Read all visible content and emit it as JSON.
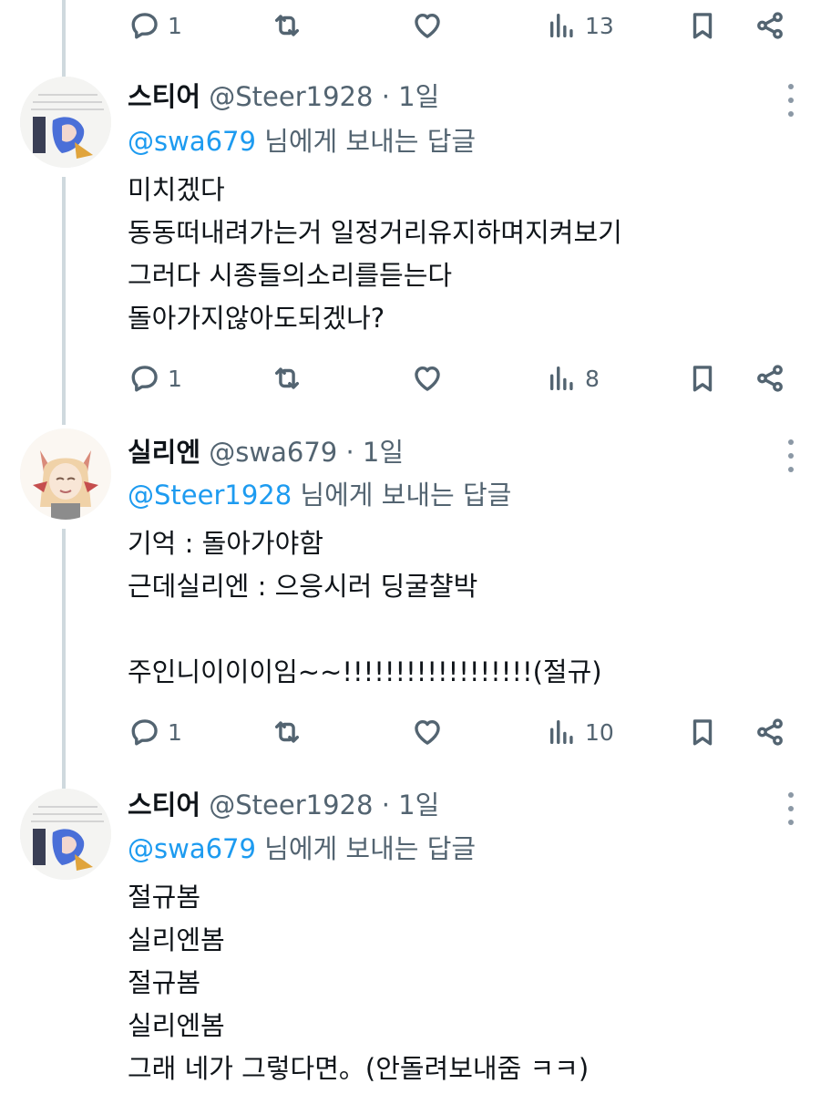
{
  "icons": [
    "reply-icon",
    "retweet-icon",
    "like-icon",
    "views-icon",
    "bookmark-icon",
    "share-icon",
    "more-icon"
  ],
  "colors": {
    "mention": "#1d9bf0",
    "muted": "#536471",
    "text": "#0f1419",
    "thread_line": "#cfd9de"
  },
  "top_actions": {
    "reply_count": "1",
    "views_count": "13"
  },
  "tweets": [
    {
      "name": "스티어",
      "handle": "@Steer1928",
      "dot": "·",
      "time": "1일",
      "reply_prefix": "@swa679",
      "reply_suffix": "님에게 보내는 답글",
      "lines": [
        "미치겠다",
        "동동떠내려가는거 일정거리유지하며지켜보기",
        "그러다 시종들의소리를듣는다",
        "돌아가지않아도되겠나?"
      ],
      "reply_count": "1",
      "views_count": "8"
    },
    {
      "name": "실리엔",
      "handle": "@swa679",
      "dot": "·",
      "time": "1일",
      "reply_prefix": "@Steer1928",
      "reply_suffix": "님에게 보내는 답글",
      "lines": [
        "기억 : 돌아가야함",
        "근데실리엔 : 으응시러 딩굴챨박",
        "",
        "주인니이이이임~~!!!!!!!!!!!!!!!!!!(절규)"
      ],
      "reply_count": "1",
      "views_count": "10"
    },
    {
      "name": "스티어",
      "handle": "@Steer1928",
      "dot": "·",
      "time": "1일",
      "reply_prefix": "@swa679",
      "reply_suffix": "님에게 보내는 답글",
      "lines": [
        "절규봄",
        "실리엔봄",
        "절규봄",
        "실리엔봄",
        "그래 네가 그렇다면。(안돌려보내줌 ㅋㅋ)"
      ]
    }
  ]
}
